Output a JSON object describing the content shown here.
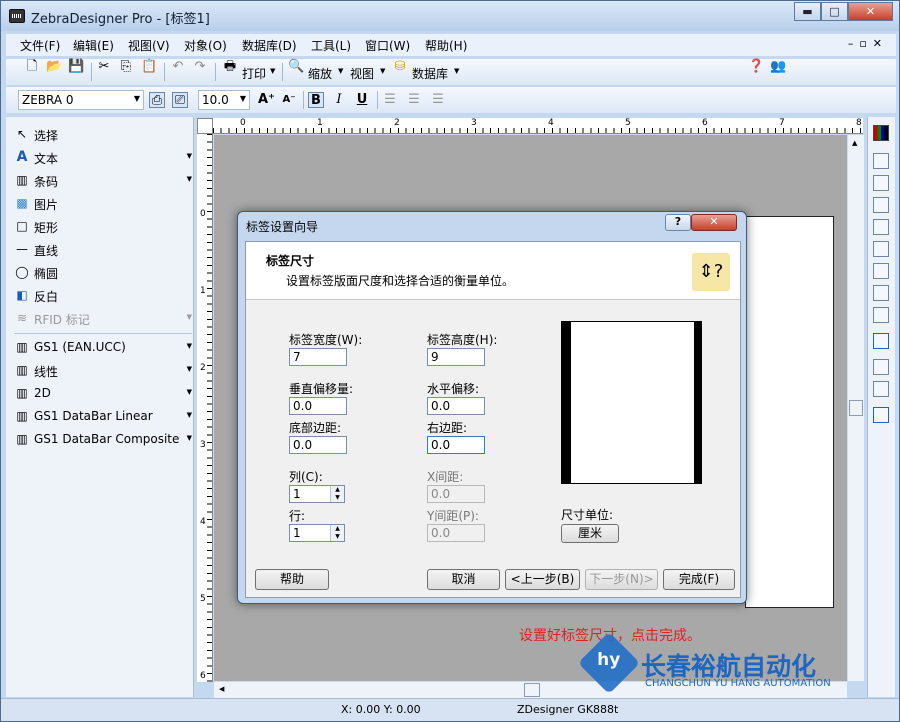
{
  "window": {
    "title": "ZebraDesigner Pro - [标签1]",
    "buttons": [
      "▬",
      "□",
      "✕"
    ]
  },
  "menu": {
    "items": [
      "文件(F)",
      "编辑(E)",
      "视图(V)",
      "对象(O)",
      "数据库(D)",
      "工具(L)",
      "窗口(W)",
      "帮助(H)"
    ]
  },
  "toolbar": {
    "print": "打印",
    "zoom": "缩放",
    "view": "视图",
    "database": "数据库"
  },
  "format_bar": {
    "printer": "ZEBRA 0",
    "font_size": "10.0",
    "bold": "B",
    "italic": "I",
    "underline": "U"
  },
  "left_panel": {
    "tools": [
      {
        "label": "选择",
        "icon": "↖"
      },
      {
        "label": "文本",
        "icon": "A"
      },
      {
        "label": "条码",
        "icon": "▥"
      },
      {
        "label": "图片",
        "icon": "▩"
      },
      {
        "label": "矩形",
        "icon": "□"
      },
      {
        "label": "直线",
        "icon": "—"
      },
      {
        "label": "椭圆",
        "icon": "◯"
      },
      {
        "label": "反白",
        "icon": "◧"
      },
      {
        "label": "RFID 标记",
        "icon": "≋"
      }
    ],
    "barcodes": [
      {
        "label": "GS1 (EAN.UCC)"
      },
      {
        "label": "线性"
      },
      {
        "label": "2D"
      },
      {
        "label": "GS1 DataBar Linear"
      },
      {
        "label": "GS1 DataBar Composite"
      }
    ]
  },
  "ruler": {
    "h": [
      "0",
      "1",
      "2",
      "3",
      "4",
      "5",
      "6",
      "7",
      "8"
    ],
    "v": [
      "0",
      "1",
      "2",
      "3",
      "4",
      "5",
      "6"
    ]
  },
  "dialog": {
    "title": "标签设置向导",
    "heading": "标签尺寸",
    "description": "设置标签版面尺度和选择合适的衡量单位。",
    "fields": {
      "width_label": "标签宽度(W):",
      "width": "7",
      "height_label": "标签高度(H):",
      "height": "9",
      "v_offset_label": "垂直偏移量:",
      "v_offset": "0.0",
      "h_offset_label": "水平偏移:",
      "h_offset": "0.0",
      "bottom_margin_label": "底部边距:",
      "bottom_margin": "0.0",
      "right_margin_label": "右边距:",
      "right_margin": "0.0",
      "columns_label": "列(C):",
      "columns": "1",
      "x_gap_label": "X间距:",
      "x_gap": "0.0",
      "rows_label": "行:",
      "rows": "1",
      "y_gap_label": "Y间距(P):",
      "y_gap": "0.0",
      "unit_label": "尺寸单位:",
      "unit": "厘米"
    },
    "buttons": {
      "help": "帮助",
      "cancel": "取消",
      "back": "<上一步(B)",
      "next": "下一步(N)>",
      "finish": "完成(F)"
    }
  },
  "annotation": "设置好标签尺寸，点击完成。",
  "watermark": {
    "cn": "长春裕航自动化",
    "en": "CHANGCHUN YU HANG AUTOMATION"
  },
  "status": {
    "coords": "X:  0.00 Y:  0.00",
    "printer": "ZDesigner GK888t"
  }
}
